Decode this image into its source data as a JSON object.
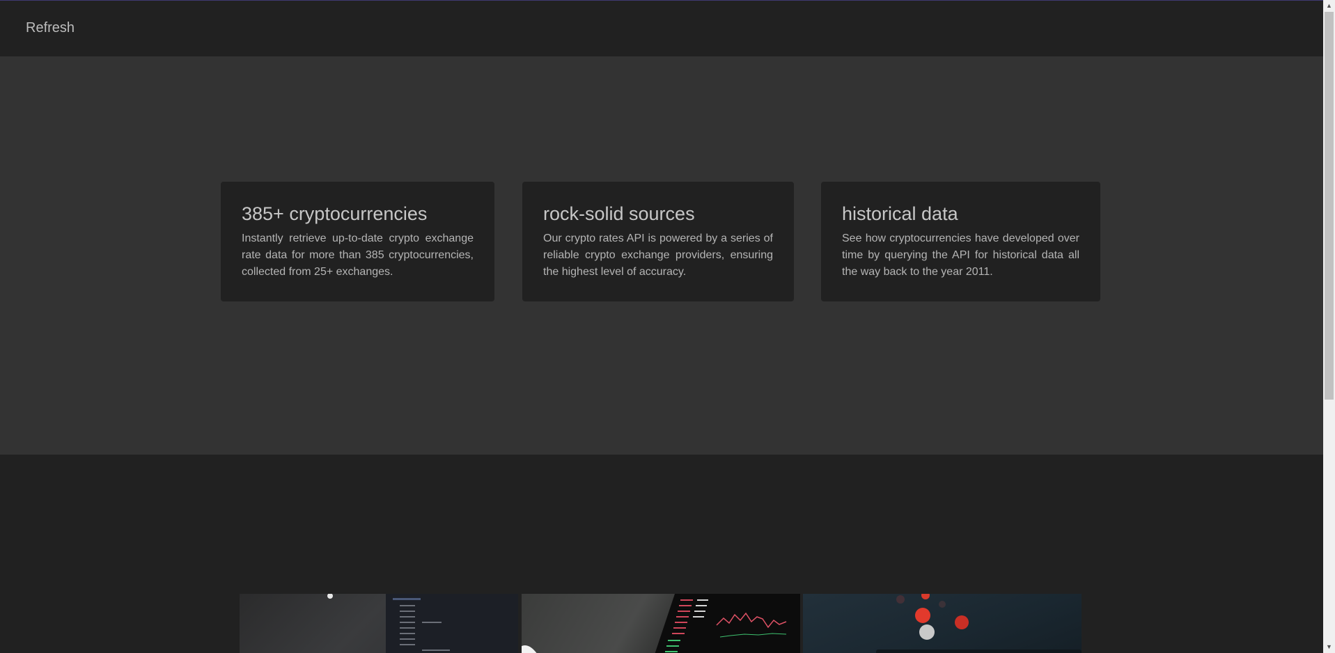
{
  "navbar": {
    "refresh_label": "Refresh"
  },
  "features": [
    {
      "title": "385+ cryptocurrencies",
      "description": "Instantly retrieve up-to-date crypto exchange rate data for more than 385 cryptocurrencies, collected from 25+ exchanges."
    },
    {
      "title": "rock-solid sources",
      "description": "Our crypto rates API is powered by a series of reliable crypto exchange providers, ensuring the highest level of accuracy."
    },
    {
      "title": "historical data",
      "description": "See how cryptocurrencies have developed over time by querying the API for historical data all the way back to the year 2011."
    }
  ],
  "colors": {
    "page_background": "#212121",
    "hero_background": "#333333",
    "card_background": "#212121",
    "text_primary": "#c7c7c7",
    "text_secondary": "#b5b5b5"
  },
  "icons": {
    "scroll_up": "triangle-up-icon",
    "scroll_down": "triangle-down-icon"
  }
}
